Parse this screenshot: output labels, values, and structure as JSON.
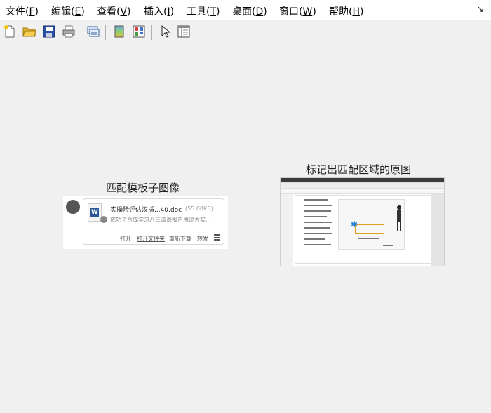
{
  "menubar": {
    "items": [
      {
        "label": "文件(",
        "key": "F",
        "suffix": ")"
      },
      {
        "label": "编辑(",
        "key": "E",
        "suffix": ")"
      },
      {
        "label": "查看(",
        "key": "V",
        "suffix": ")"
      },
      {
        "label": "插入(",
        "key": "I",
        "suffix": ")"
      },
      {
        "label": "工具(",
        "key": "T",
        "suffix": ")"
      },
      {
        "label": "桌面(",
        "key": "D",
        "suffix": ")"
      },
      {
        "label": "窗口(",
        "key": "W",
        "suffix": ")"
      },
      {
        "label": "帮助(",
        "key": "H",
        "suffix": ")"
      }
    ],
    "restore_icon": "↘"
  },
  "toolbar": {
    "buttons": [
      "new-file-icon",
      "open-folder-icon",
      "save-icon",
      "print-icon",
      "screenshot-icon",
      "color-icon",
      "layout-icon",
      "pointer-icon",
      "panel-icon"
    ]
  },
  "template_panel": {
    "caption": "匹配模板子图像",
    "file_name": "实操险评估汉插...40.doc",
    "file_size": "(55.00KB)",
    "description": "成功了合成学习八三该课报告用途大实...",
    "actions": [
      "打开",
      "打开文件夹",
      "重新下载",
      "转发"
    ]
  },
  "original_panel": {
    "caption": "标记出匹配区域的原图"
  },
  "colors": {
    "accent_highlight": "#e0a020",
    "marker": "#2a80d0",
    "word_blue": "#2b579a"
  }
}
